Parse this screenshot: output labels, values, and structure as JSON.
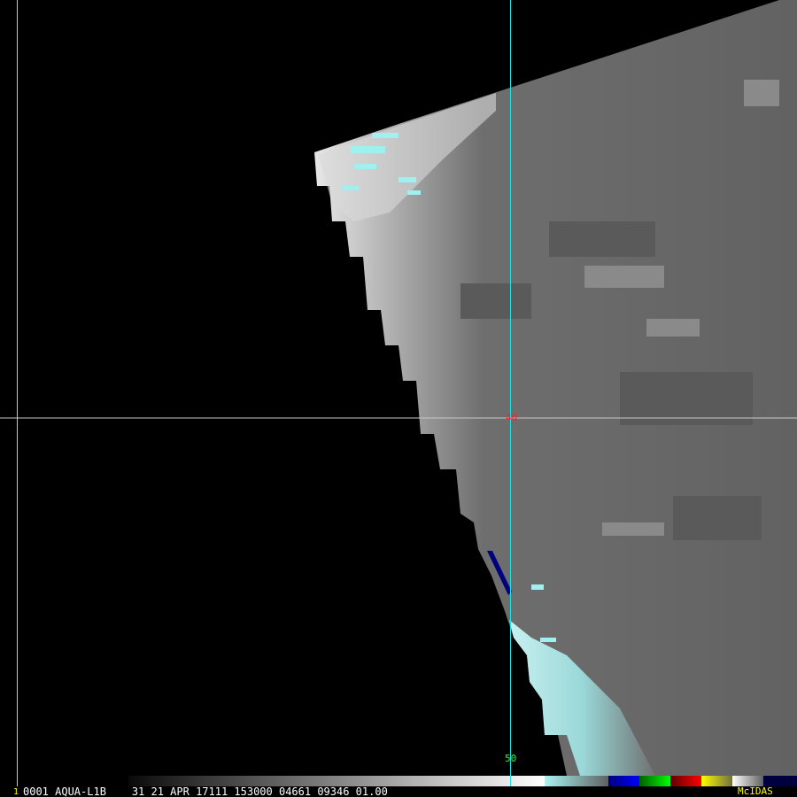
{
  "image": {
    "grid_labels": {
      "lat_40": "40",
      "lat_50": "50"
    },
    "grid_colors": {
      "lat_40": "#ff2020",
      "lat_50": "#30ff30",
      "meridian": "#20e0e0",
      "grid": "#c8c8c8"
    }
  },
  "status_bar": {
    "frame_number": "1",
    "text": "0001 AQUA-L1B    31 21 APR 17111 153000 04661 09346 01.00",
    "brand": "McIDAS"
  },
  "colorbar": {
    "segments": [
      {
        "name": "grayscale",
        "from": "#0a0a0a",
        "to": "#ffffff"
      },
      {
        "name": "cyan",
        "from": "#a8f4f4",
        "to": "#606060"
      },
      {
        "name": "blue",
        "from": "#000080",
        "to": "#0000ff"
      },
      {
        "name": "green",
        "from": "#006000",
        "to": "#00ff00"
      },
      {
        "name": "red",
        "from": "#600000",
        "to": "#ff0000"
      },
      {
        "name": "yellow",
        "from": "#ffff00",
        "to": "#707040"
      },
      {
        "name": "white-gray",
        "from": "#ffffff",
        "to": "#606060"
      },
      {
        "name": "navy",
        "from": "#000040",
        "to": "#000040"
      }
    ]
  }
}
